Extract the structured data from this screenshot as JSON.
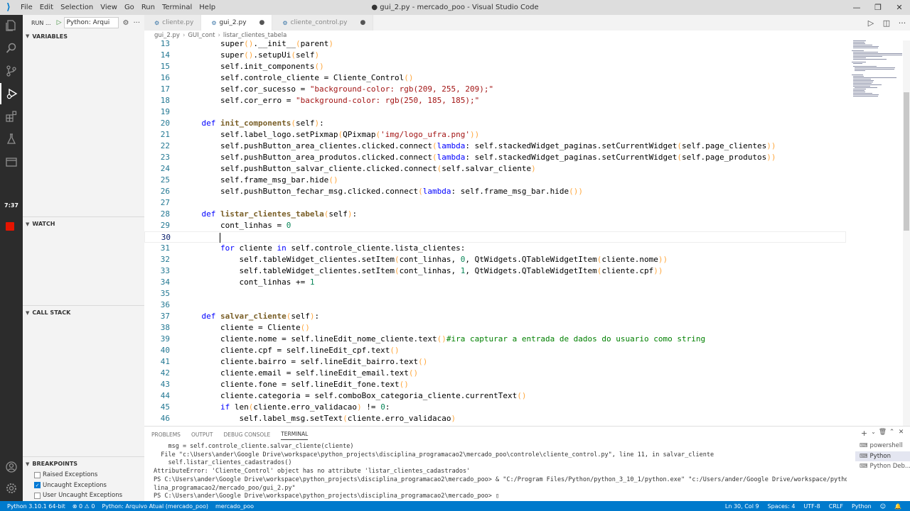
{
  "window": {
    "title": "● gui_2.py - mercado_poo - Visual Studio Code",
    "menu": [
      "File",
      "Edit",
      "Selection",
      "View",
      "Go",
      "Run",
      "Terminal",
      "Help"
    ]
  },
  "activity": {
    "timer": "7:37"
  },
  "sidebar": {
    "run_label": "RUN ...",
    "config": "Python: Arqui",
    "sections": {
      "variables": "VARIABLES",
      "watch": "WATCH",
      "call_stack": "CALL STACK",
      "breakpoints": "BREAKPOINTS"
    },
    "breakpoints": [
      {
        "label": "Raised Exceptions",
        "checked": false
      },
      {
        "label": "Uncaught Exceptions",
        "checked": true
      },
      {
        "label": "User Uncaught Exceptions",
        "checked": false
      }
    ]
  },
  "tabs": [
    {
      "label": "cliente.py",
      "active": false,
      "modified": false
    },
    {
      "label": "gui_2.py",
      "active": true,
      "modified": true
    },
    {
      "label": "cliente_control.py",
      "active": false,
      "modified": true
    }
  ],
  "breadcrumb": [
    "gui_2.py",
    "GUI_cont",
    "listar_clientes_tabela"
  ],
  "editor": {
    "current_line": 30,
    "lines": [
      {
        "n": 13,
        "code": "        super().__init__(parent)"
      },
      {
        "n": 14,
        "code": "        super().setupUi(self)"
      },
      {
        "n": 15,
        "code": "        self.init_components()"
      },
      {
        "n": 16,
        "code": "        self.controle_cliente = Cliente_Control()"
      },
      {
        "n": 17,
        "code": "        self.cor_sucesso = \"background-color: rgb(209, 255, 209);\""
      },
      {
        "n": 18,
        "code": "        self.cor_erro = \"background-color: rgb(250, 185, 185);\""
      },
      {
        "n": 19,
        "code": ""
      },
      {
        "n": 20,
        "code": "    def init_components(self):"
      },
      {
        "n": 21,
        "code": "        self.label_logo.setPixmap(QPixmap('img/logo_ufra.png'))"
      },
      {
        "n": 22,
        "code": "        self.pushButton_area_clientes.clicked.connect(lambda: self.stackedWidget_paginas.setCurrentWidget(self.page_clientes))"
      },
      {
        "n": 23,
        "code": "        self.pushButton_area_produtos.clicked.connect(lambda: self.stackedWidget_paginas.setCurrentWidget(self.page_produtos))"
      },
      {
        "n": 24,
        "code": "        self.pushButton_salvar_cliente.clicked.connect(self.salvar_cliente)"
      },
      {
        "n": 25,
        "code": "        self.frame_msg_bar.hide()"
      },
      {
        "n": 26,
        "code": "        self.pushButton_fechar_msg.clicked.connect(lambda: self.frame_msg_bar.hide())"
      },
      {
        "n": 27,
        "code": ""
      },
      {
        "n": 28,
        "code": "    def listar_clientes_tabela(self):"
      },
      {
        "n": 29,
        "code": "        cont_linhas = 0"
      },
      {
        "n": 30,
        "code": ""
      },
      {
        "n": 31,
        "code": "        for cliente in self.controle_cliente.lista_clientes:"
      },
      {
        "n": 32,
        "code": "            self.tableWidget_clientes.setItem(cont_linhas, 0, QtWidgets.QTableWidgetItem(cliente.nome))"
      },
      {
        "n": 33,
        "code": "            self.tableWidget_clientes.setItem(cont_linhas, 1, QtWidgets.QTableWidgetItem(cliente.cpf))"
      },
      {
        "n": 34,
        "code": "            cont_linhas += 1"
      },
      {
        "n": 35,
        "code": ""
      },
      {
        "n": 36,
        "code": ""
      },
      {
        "n": 37,
        "code": "    def salvar_cliente(self):"
      },
      {
        "n": 38,
        "code": "        cliente = Cliente()"
      },
      {
        "n": 39,
        "code": "        cliente.nome = self.lineEdit_nome_cliente.text()#ira capturar a entrada de dados do usuario como string"
      },
      {
        "n": 40,
        "code": "        cliente.cpf = self.lineEdit_cpf.text()"
      },
      {
        "n": 41,
        "code": "        cliente.bairro = self.lineEdit_bairro.text()"
      },
      {
        "n": 42,
        "code": "        cliente.email = self.lineEdit_email.text()"
      },
      {
        "n": 43,
        "code": "        cliente.fone = self.lineEdit_fone.text()"
      },
      {
        "n": 44,
        "code": "        cliente.categoria = self.comboBox_categoria_cliente.currentText()"
      },
      {
        "n": 45,
        "code": "        if len(cliente.erro_validacao) != 0:"
      },
      {
        "n": 46,
        "code": "            self.label_msg.setText(cliente.erro_validacao)"
      }
    ]
  },
  "panel": {
    "tabs": [
      "PROBLEMS",
      "OUTPUT",
      "DEBUG CONSOLE",
      "TERMINAL"
    ],
    "active_tab": 3,
    "terminal_lines": [
      "    msg = self.controle_cliente.salvar_cliente(cliente)",
      "  File \"c:\\Users\\ander\\Google Drive\\workspace\\python_projects\\disciplina_programacao2\\mercado_poo\\controle\\cliente_control.py\", line 11, in salvar_cliente",
      "    self.listar_clientes_cadastrados()",
      "AttributeError: 'Cliente_Control' object has no attribute 'listar_clientes_cadastrados'",
      "PS C:\\Users\\ander\\Google Drive\\workspace\\python_projects\\disciplina_programacao2\\mercado_poo> & \"C:/Program Files/Python/python_3_10_1/python.exe\" \"c:/Users/ander/Google Drive/workspace/python_projects/discip",
      "lina_programacao2/mercado_poo/gui_2.py\"",
      "PS C:\\Users\\ander\\Google Drive\\workspace\\python_projects\\disciplina_programacao2\\mercado_poo> "
    ],
    "terminals": [
      {
        "label": "powershell",
        "active": false
      },
      {
        "label": "Python",
        "active": true
      },
      {
        "label": "Python Deb...",
        "active": false
      }
    ]
  },
  "status": {
    "python": "Python 3.10.1 64-bit",
    "problems": "⊗ 0 ⚠ 0",
    "config": "Python: Arquivo Atual (mercado_poo)",
    "folder": "mercado_poo",
    "position": "Ln 30, Col 9",
    "spaces": "Spaces: 4",
    "encoding": "UTF-8",
    "eol": "CRLF",
    "language": "Python"
  },
  "colors": {
    "status_bar": "#007acc",
    "activity_bar": "#2c2c2c",
    "keyword": "#0000ff",
    "string": "#a31515",
    "number": "#098658",
    "comment": "#008000"
  }
}
